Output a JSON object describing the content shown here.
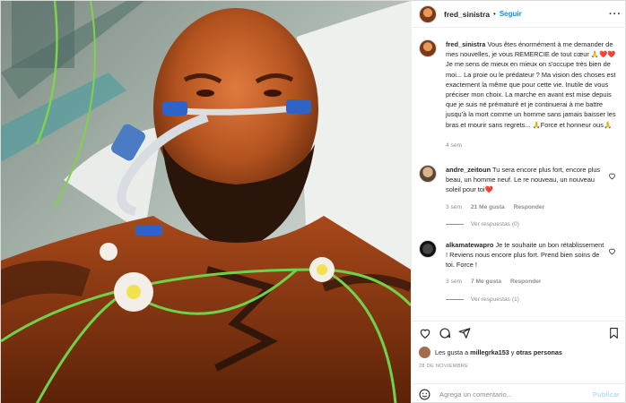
{
  "post": {
    "username": "fred_sinistra",
    "separator": "•",
    "follow_label": "Seguir",
    "more_label": "···"
  },
  "caption": {
    "username": "fred_sinistra",
    "text": "Vous êtes énormément à me demander de mes nouvelles, je vous REMERCIE de tout cœur 🙏❤️❤️Je me sens de mieux en mieux on s'occupe très bien de moi... La proie ou le prédateur ? Ma vision des choses est exactement la même que pour cette vie. Inutile de vous préciser mon choix. La marche en avant est mise depuis que je suis né prématuré et je continuerai à me battre jusqu'à la mort comme un homme sans jamais baisser les bras et mourir sans regrets... 🙏Force et honneur ous🙏",
    "time": "4 sem"
  },
  "comments": [
    {
      "username": "andre_zeitoun",
      "text": "Tu sera encore plus fort, encore plus beau, un homme neuf. Le re nouveau, un nouveau soleil pour toi❤️",
      "time": "3 sem",
      "likes": "21 Me gusta",
      "reply": "Responder",
      "replies": "Ver respuestas (0)"
    },
    {
      "username": "alkamatewapro",
      "text": "Je te souhaite un bon rétablissement ! Reviens nous encore plus fort. Prend bien soins de toi. Force !",
      "time": "3 sem",
      "likes": "7 Me gusta",
      "reply": "Responder",
      "replies": "Ver respuestas (1)"
    }
  ],
  "likes": {
    "prefix": "Les gusta a",
    "user": "millegrka153",
    "middle": "y",
    "others": "otras personas"
  },
  "date": "28 DE NOVIEMBRE",
  "add_comment": {
    "placeholder": "Agrega un comentario...",
    "publish_label": "Publicar"
  },
  "icons": [
    "heart-icon",
    "comment-icon",
    "share-icon",
    "bookmark-icon",
    "smiley-icon",
    "more-icon"
  ]
}
